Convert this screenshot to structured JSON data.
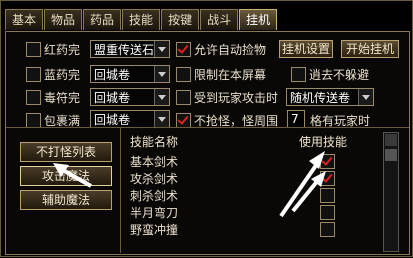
{
  "tabs": [
    "基本",
    "物品",
    "药品",
    "技能",
    "按键",
    "战斗",
    "挂机"
  ],
  "active_tab": "挂机",
  "row1": {
    "label": "红药完",
    "select": "盟重传送石",
    "auto_pick": "允许自动捡物",
    "btn1": "挂机设置",
    "btn2": "开始挂机"
  },
  "row2": {
    "label": "蓝药完",
    "select": "回城卷",
    "limit": "限制在本屏幕",
    "avoid": "逍去不躲避"
  },
  "row3": {
    "label": "毒符完",
    "select": "回城卷",
    "attacked": "受到玩家攻击时",
    "random": "随机传送卷"
  },
  "row4": {
    "label": "包裹满",
    "select": "回城卷",
    "no_grab": "不抢怪，怪周围",
    "count": "7",
    "has_player": "格有玩家时"
  },
  "left_buttons": [
    "不打怪列表",
    "攻击魔法",
    "辅助魔法"
  ],
  "table": {
    "col_name": "技能名称",
    "col_use": "使用技能",
    "rows": [
      {
        "name": "基本剑术",
        "checked": true
      },
      {
        "name": "攻杀剑术",
        "checked": true
      },
      {
        "name": "刺杀剑术",
        "checked": false
      },
      {
        "name": "半月弯刀",
        "checked": false
      },
      {
        "name": "野蛮冲撞",
        "checked": false
      }
    ]
  },
  "colors": {
    "accent": "#e02020",
    "border": "#8a7850"
  }
}
